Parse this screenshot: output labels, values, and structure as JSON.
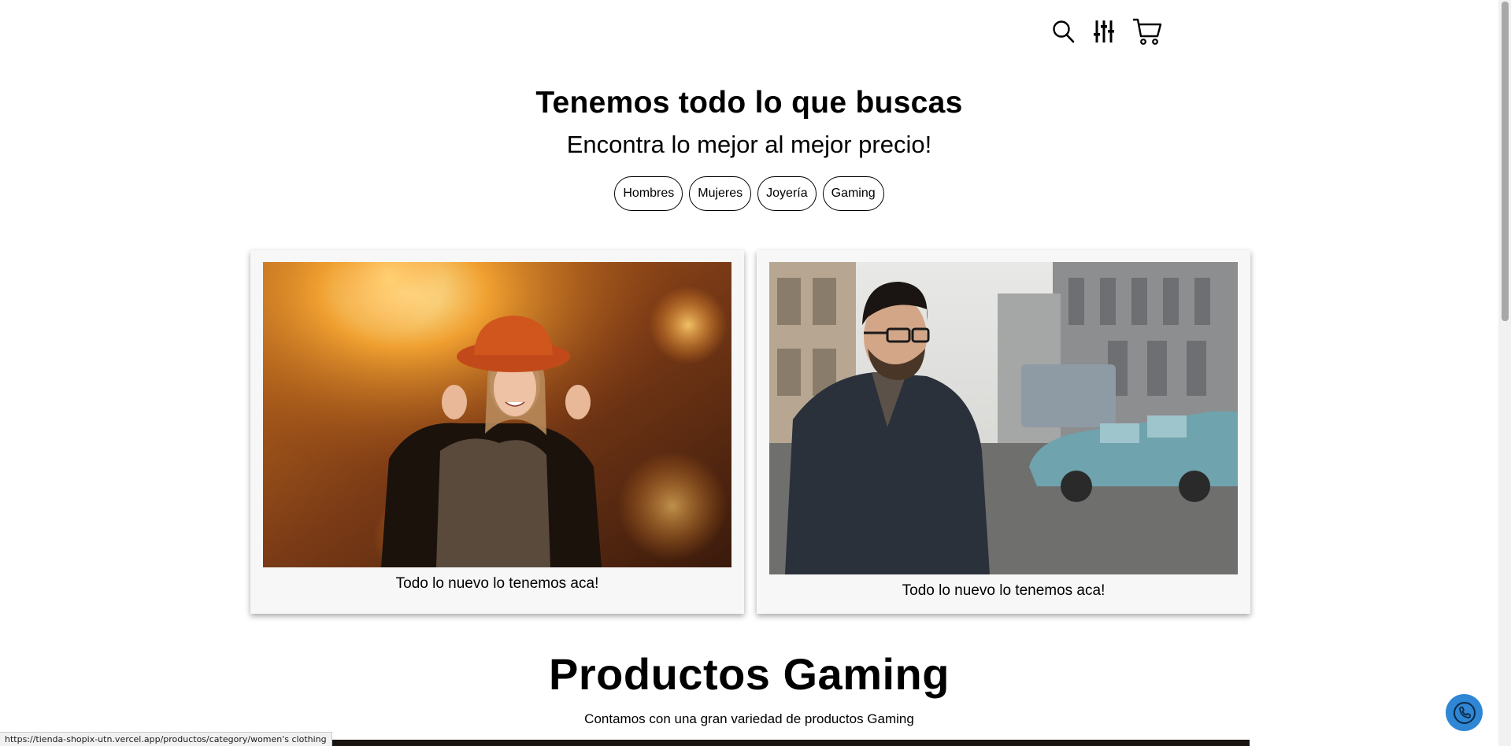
{
  "header": {
    "icons": [
      "search-icon",
      "filter-sliders-icon",
      "cart-icon"
    ]
  },
  "hero": {
    "title": "Tenemos todo lo que buscas",
    "subtitle": "Encontra lo mejor al mejor precio!",
    "categories": [
      "Hombres",
      "Mujeres",
      "Joyería",
      "Gaming"
    ]
  },
  "cards": [
    {
      "caption": "Todo lo nuevo lo tenemos aca!",
      "image": "woman-autumn-hat-photo"
    },
    {
      "caption": "Todo lo nuevo lo tenemos aca!",
      "image": "man-city-street-photo"
    }
  ],
  "section": {
    "title": "Productos Gaming",
    "subtitle": "Contamos con una gran variedad de productos Gaming"
  },
  "status_bar": {
    "url": "https://tienda-shopix-utn.vercel.app/productos/category/women's clothing"
  },
  "floating": {
    "icon": "phone-icon",
    "color": "#2e86d4"
  }
}
